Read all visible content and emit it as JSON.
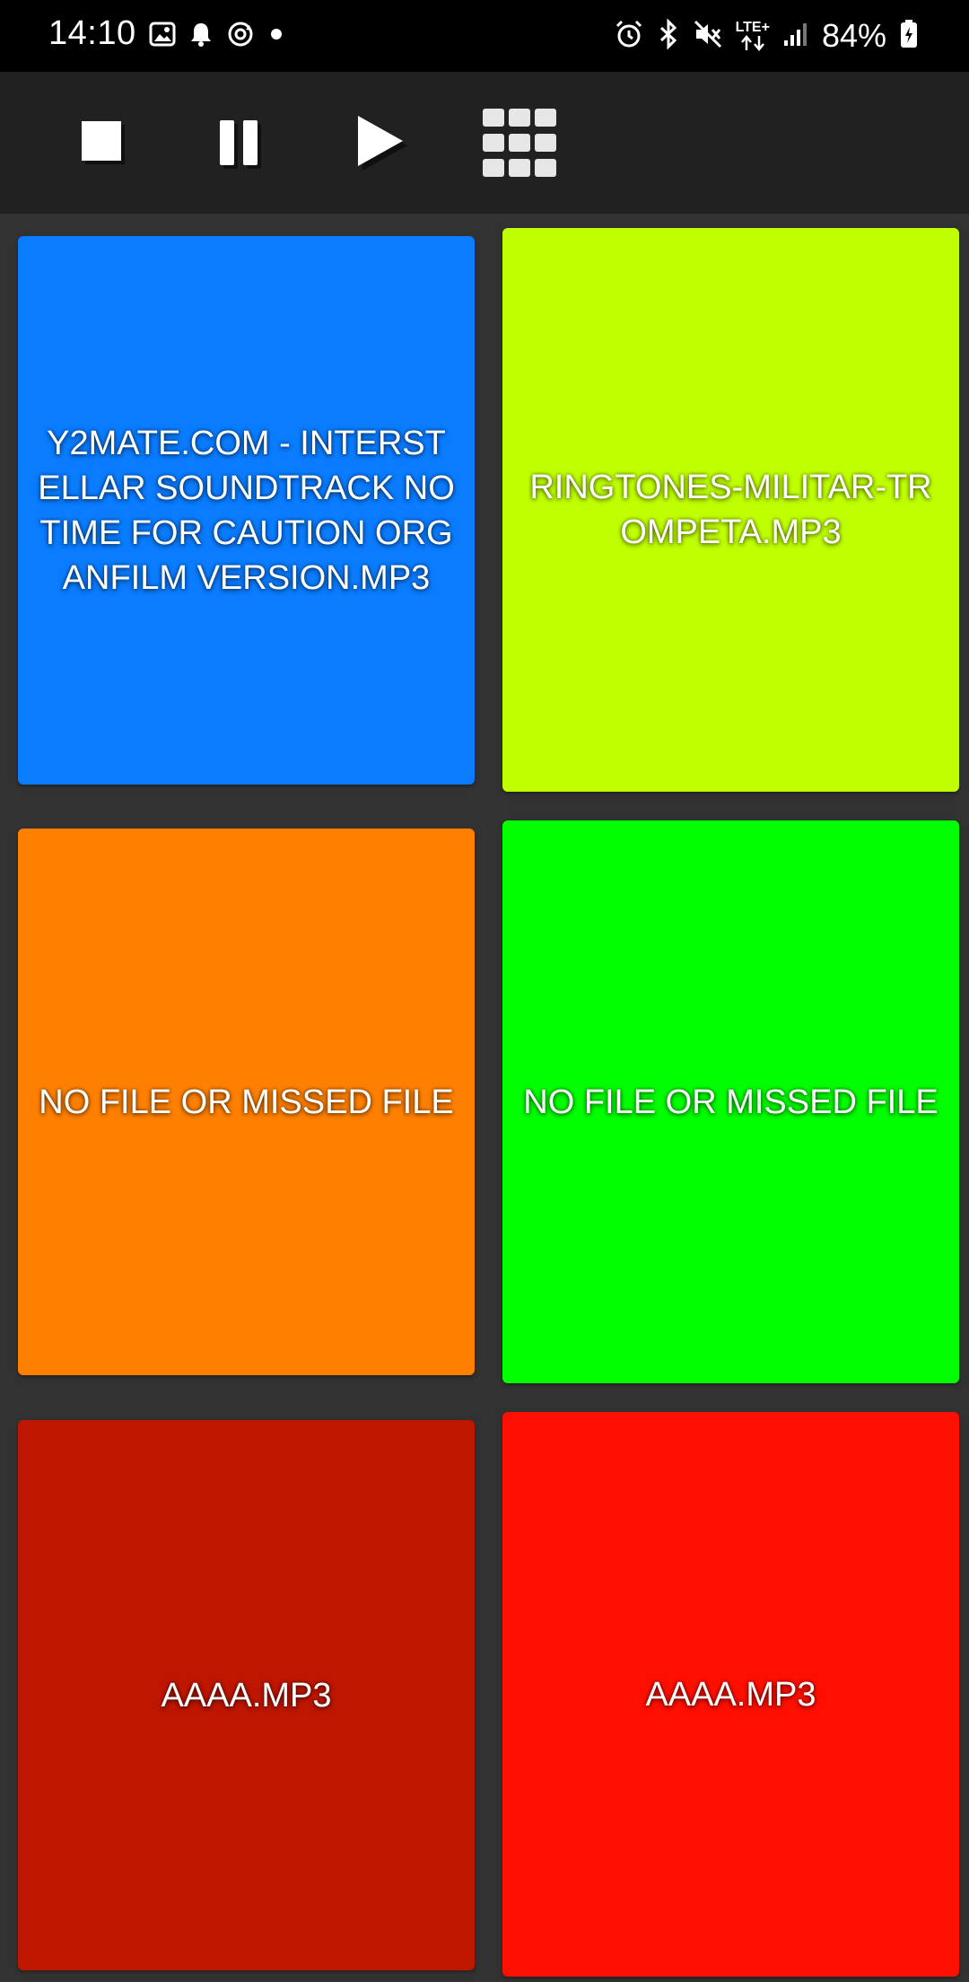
{
  "status_bar": {
    "time": "14:10",
    "left_icons": [
      "gallery-icon",
      "bell-icon",
      "sync-icon",
      "dot-icon"
    ],
    "right_icons": [
      "alarm-icon",
      "bluetooth-icon",
      "mute-icon",
      "lte-icon",
      "signal-icon"
    ],
    "network": "LTE+",
    "battery": "84%"
  },
  "toolbar": {
    "buttons": [
      {
        "name": "stop",
        "icon": "stop-icon"
      },
      {
        "name": "pause",
        "icon": "pause-icon"
      },
      {
        "name": "play",
        "icon": "play-icon"
      },
      {
        "name": "grid",
        "icon": "grid-icon"
      }
    ]
  },
  "pads": [
    {
      "label": "Y2MATE.COM - INTERSTELLAR SOUNDTRACK  NO TIME FOR CAUTION ORGANFILM VERSION.MP3",
      "color": "#0A7CFF"
    },
    {
      "label": "RINGTONES-MILITAR-TROMPETA.MP3",
      "color": "#BFFF00"
    },
    {
      "label": "NO FILE OR MISSED FILE",
      "color": "#FF8000"
    },
    {
      "label": "NO FILE OR MISSED FILE",
      "color": "#00FF00"
    },
    {
      "label": "AAAA.MP3",
      "color": "#BF1600"
    },
    {
      "label": "AAAA.MP3",
      "color": "#FF0F00"
    }
  ],
  "colors": {
    "status_bar_bg": "#000000",
    "toolbar_bg": "#212121",
    "grid_bg": "#323232"
  }
}
